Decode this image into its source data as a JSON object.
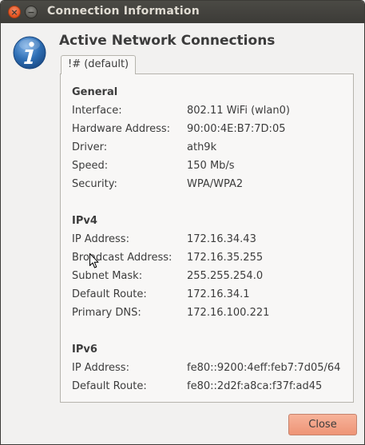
{
  "window": {
    "title": "Connection Information",
    "close_glyph": "×",
    "minimize_glyph": "−"
  },
  "header": {
    "icon": "info-icon",
    "title": "Active Network Connections"
  },
  "tabs": [
    {
      "label": "!# (default)",
      "selected": true
    }
  ],
  "sections": {
    "general": {
      "title": "General",
      "rows": [
        {
          "label": "Interface:",
          "value": "802.11 WiFi (wlan0)"
        },
        {
          "label": "Hardware Address:",
          "value": "90:00:4E:B7:7D:05"
        },
        {
          "label": "Driver:",
          "value": "ath9k"
        },
        {
          "label": "Speed:",
          "value": "150 Mb/s"
        },
        {
          "label": "Security:",
          "value": "WPA/WPA2"
        }
      ]
    },
    "ipv4": {
      "title": "IPv4",
      "rows": [
        {
          "label": "IP Address:",
          "value": "172.16.34.43"
        },
        {
          "label": "Broadcast Address:",
          "value": "172.16.35.255"
        },
        {
          "label": "Subnet Mask:",
          "value": "255.255.254.0"
        },
        {
          "label": "Default Route:",
          "value": "172.16.34.1"
        },
        {
          "label": "Primary DNS:",
          "value": "172.16.100.221"
        }
      ]
    },
    "ipv6": {
      "title": "IPv6",
      "rows": [
        {
          "label": "IP Address:",
          "value": "fe80::9200:4eff:feb7:7d05/64"
        },
        {
          "label": "Default Route:",
          "value": "fe80::2d2f:a8ca:f37f:ad45"
        }
      ]
    }
  },
  "buttons": {
    "close_label": "Close"
  },
  "colors": {
    "titlebar": "#3c3b37",
    "close_button": "#ee9476",
    "info_icon": "#2f6fb5"
  }
}
